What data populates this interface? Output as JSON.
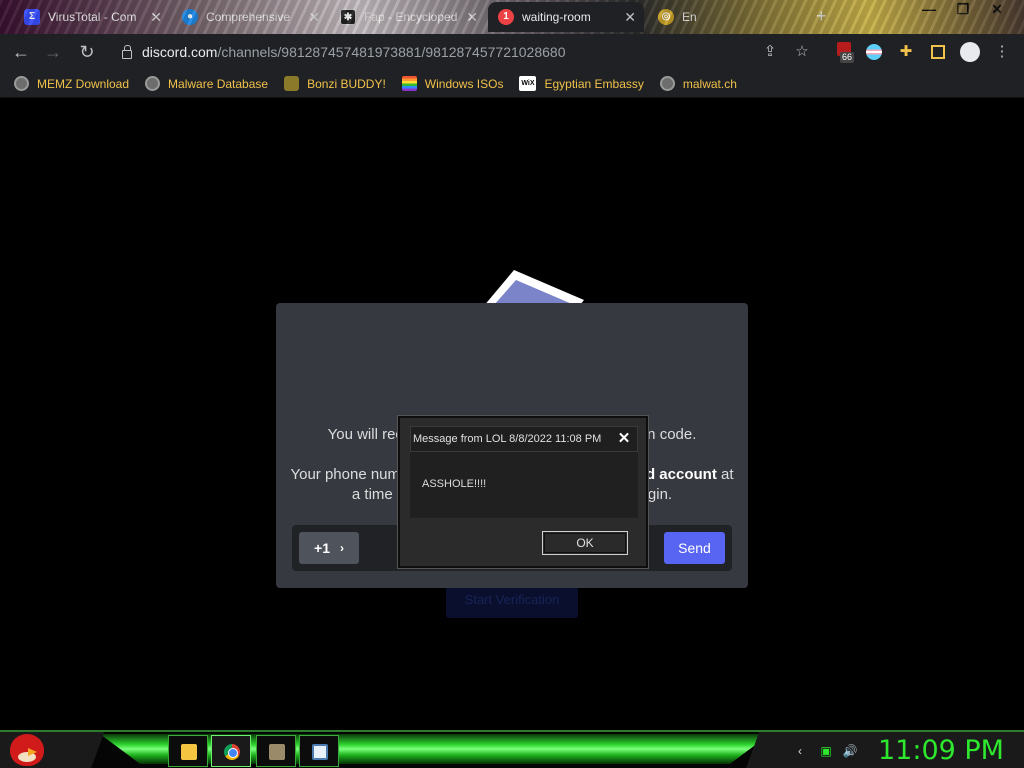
{
  "browser": {
    "tabs": [
      {
        "label": "VirusTotal - Com",
        "icon": "virustotal-icon",
        "color": "#394eff",
        "active": false
      },
      {
        "label": "Comprehensive",
        "icon": "location-pin-icon",
        "color": "#1e88e5",
        "active": false
      },
      {
        "label": "Fap - Encycloped",
        "icon": "encyclopedia-icon",
        "color": "#222222",
        "active": false
      },
      {
        "label": "waiting-room",
        "icon": "discord-icon",
        "color": "#ed4245",
        "active": true
      },
      {
        "label": "En",
        "icon": "globe-icon",
        "color": "#c9a227",
        "active": false
      }
    ],
    "url_host": "discord.com",
    "url_path": "/channels/981287457481973881/981287457721028680",
    "extension_badge": "66",
    "bookmarks": [
      {
        "label": "MEMZ Download",
        "icon": "globe-icon"
      },
      {
        "label": "Malware Database",
        "icon": "globe-icon"
      },
      {
        "label": "Bonzi BUDDY!",
        "icon": "bonzi-icon"
      },
      {
        "label": "Windows ISOs",
        "icon": "rainbow-flag-icon"
      },
      {
        "label": "Egyptian Embassy",
        "icon": "wix-icon"
      },
      {
        "label": "malwat.ch",
        "icon": "globe-icon"
      }
    ]
  },
  "modal": {
    "line1": "You will receive a text message with a verification code.",
    "line2_a": "Your phone number can be used to verify ",
    "line2_b": "one Discord account",
    "line2_c": " at",
    "line3": "a time and is only used for verification and login.",
    "country_code": "+1",
    "send_label": "Send"
  },
  "background_page": {
    "button_label": "Start Verification"
  },
  "dialog": {
    "title": "Message from LOL 8/8/2022 11:08 PM",
    "message": "ASSHOLE!!!!",
    "ok_label": "OK"
  },
  "taskbar": {
    "clock": "11:09 PM"
  }
}
